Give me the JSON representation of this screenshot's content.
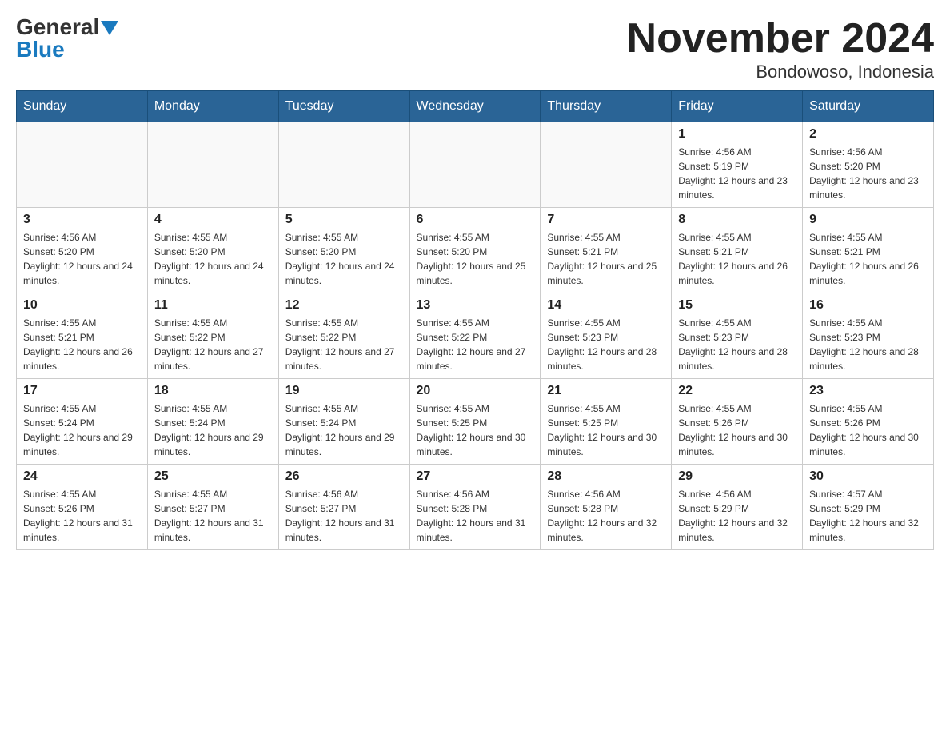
{
  "header": {
    "logo_general": "General",
    "logo_blue": "Blue",
    "title": "November 2024",
    "subtitle": "Bondowoso, Indonesia"
  },
  "weekdays": [
    "Sunday",
    "Monday",
    "Tuesday",
    "Wednesday",
    "Thursday",
    "Friday",
    "Saturday"
  ],
  "weeks": [
    [
      {
        "day": "",
        "sunrise": "",
        "sunset": "",
        "daylight": ""
      },
      {
        "day": "",
        "sunrise": "",
        "sunset": "",
        "daylight": ""
      },
      {
        "day": "",
        "sunrise": "",
        "sunset": "",
        "daylight": ""
      },
      {
        "day": "",
        "sunrise": "",
        "sunset": "",
        "daylight": ""
      },
      {
        "day": "",
        "sunrise": "",
        "sunset": "",
        "daylight": ""
      },
      {
        "day": "1",
        "sunrise": "Sunrise: 4:56 AM",
        "sunset": "Sunset: 5:19 PM",
        "daylight": "Daylight: 12 hours and 23 minutes."
      },
      {
        "day": "2",
        "sunrise": "Sunrise: 4:56 AM",
        "sunset": "Sunset: 5:20 PM",
        "daylight": "Daylight: 12 hours and 23 minutes."
      }
    ],
    [
      {
        "day": "3",
        "sunrise": "Sunrise: 4:56 AM",
        "sunset": "Sunset: 5:20 PM",
        "daylight": "Daylight: 12 hours and 24 minutes."
      },
      {
        "day": "4",
        "sunrise": "Sunrise: 4:55 AM",
        "sunset": "Sunset: 5:20 PM",
        "daylight": "Daylight: 12 hours and 24 minutes."
      },
      {
        "day": "5",
        "sunrise": "Sunrise: 4:55 AM",
        "sunset": "Sunset: 5:20 PM",
        "daylight": "Daylight: 12 hours and 24 minutes."
      },
      {
        "day": "6",
        "sunrise": "Sunrise: 4:55 AM",
        "sunset": "Sunset: 5:20 PM",
        "daylight": "Daylight: 12 hours and 25 minutes."
      },
      {
        "day": "7",
        "sunrise": "Sunrise: 4:55 AM",
        "sunset": "Sunset: 5:21 PM",
        "daylight": "Daylight: 12 hours and 25 minutes."
      },
      {
        "day": "8",
        "sunrise": "Sunrise: 4:55 AM",
        "sunset": "Sunset: 5:21 PM",
        "daylight": "Daylight: 12 hours and 26 minutes."
      },
      {
        "day": "9",
        "sunrise": "Sunrise: 4:55 AM",
        "sunset": "Sunset: 5:21 PM",
        "daylight": "Daylight: 12 hours and 26 minutes."
      }
    ],
    [
      {
        "day": "10",
        "sunrise": "Sunrise: 4:55 AM",
        "sunset": "Sunset: 5:21 PM",
        "daylight": "Daylight: 12 hours and 26 minutes."
      },
      {
        "day": "11",
        "sunrise": "Sunrise: 4:55 AM",
        "sunset": "Sunset: 5:22 PM",
        "daylight": "Daylight: 12 hours and 27 minutes."
      },
      {
        "day": "12",
        "sunrise": "Sunrise: 4:55 AM",
        "sunset": "Sunset: 5:22 PM",
        "daylight": "Daylight: 12 hours and 27 minutes."
      },
      {
        "day": "13",
        "sunrise": "Sunrise: 4:55 AM",
        "sunset": "Sunset: 5:22 PM",
        "daylight": "Daylight: 12 hours and 27 minutes."
      },
      {
        "day": "14",
        "sunrise": "Sunrise: 4:55 AM",
        "sunset": "Sunset: 5:23 PM",
        "daylight": "Daylight: 12 hours and 28 minutes."
      },
      {
        "day": "15",
        "sunrise": "Sunrise: 4:55 AM",
        "sunset": "Sunset: 5:23 PM",
        "daylight": "Daylight: 12 hours and 28 minutes."
      },
      {
        "day": "16",
        "sunrise": "Sunrise: 4:55 AM",
        "sunset": "Sunset: 5:23 PM",
        "daylight": "Daylight: 12 hours and 28 minutes."
      }
    ],
    [
      {
        "day": "17",
        "sunrise": "Sunrise: 4:55 AM",
        "sunset": "Sunset: 5:24 PM",
        "daylight": "Daylight: 12 hours and 29 minutes."
      },
      {
        "day": "18",
        "sunrise": "Sunrise: 4:55 AM",
        "sunset": "Sunset: 5:24 PM",
        "daylight": "Daylight: 12 hours and 29 minutes."
      },
      {
        "day": "19",
        "sunrise": "Sunrise: 4:55 AM",
        "sunset": "Sunset: 5:24 PM",
        "daylight": "Daylight: 12 hours and 29 minutes."
      },
      {
        "day": "20",
        "sunrise": "Sunrise: 4:55 AM",
        "sunset": "Sunset: 5:25 PM",
        "daylight": "Daylight: 12 hours and 30 minutes."
      },
      {
        "day": "21",
        "sunrise": "Sunrise: 4:55 AM",
        "sunset": "Sunset: 5:25 PM",
        "daylight": "Daylight: 12 hours and 30 minutes."
      },
      {
        "day": "22",
        "sunrise": "Sunrise: 4:55 AM",
        "sunset": "Sunset: 5:26 PM",
        "daylight": "Daylight: 12 hours and 30 minutes."
      },
      {
        "day": "23",
        "sunrise": "Sunrise: 4:55 AM",
        "sunset": "Sunset: 5:26 PM",
        "daylight": "Daylight: 12 hours and 30 minutes."
      }
    ],
    [
      {
        "day": "24",
        "sunrise": "Sunrise: 4:55 AM",
        "sunset": "Sunset: 5:26 PM",
        "daylight": "Daylight: 12 hours and 31 minutes."
      },
      {
        "day": "25",
        "sunrise": "Sunrise: 4:55 AM",
        "sunset": "Sunset: 5:27 PM",
        "daylight": "Daylight: 12 hours and 31 minutes."
      },
      {
        "day": "26",
        "sunrise": "Sunrise: 4:56 AM",
        "sunset": "Sunset: 5:27 PM",
        "daylight": "Daylight: 12 hours and 31 minutes."
      },
      {
        "day": "27",
        "sunrise": "Sunrise: 4:56 AM",
        "sunset": "Sunset: 5:28 PM",
        "daylight": "Daylight: 12 hours and 31 minutes."
      },
      {
        "day": "28",
        "sunrise": "Sunrise: 4:56 AM",
        "sunset": "Sunset: 5:28 PM",
        "daylight": "Daylight: 12 hours and 32 minutes."
      },
      {
        "day": "29",
        "sunrise": "Sunrise: 4:56 AM",
        "sunset": "Sunset: 5:29 PM",
        "daylight": "Daylight: 12 hours and 32 minutes."
      },
      {
        "day": "30",
        "sunrise": "Sunrise: 4:57 AM",
        "sunset": "Sunset: 5:29 PM",
        "daylight": "Daylight: 12 hours and 32 minutes."
      }
    ]
  ]
}
